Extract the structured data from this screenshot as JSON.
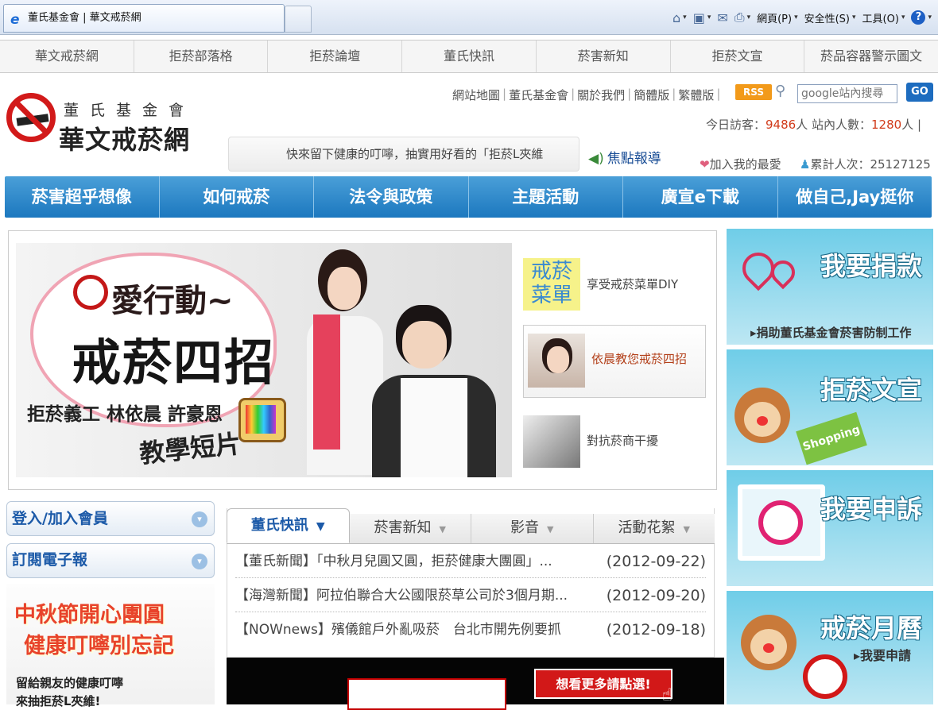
{
  "browser": {
    "tab_title": "董氏基金會 | 華文戒菸網",
    "toolbar": {
      "page_label": "網頁(P)",
      "safety_label": "安全性(S)",
      "tools_label": "工具(O)"
    }
  },
  "top_nav": [
    "華文戒菸網",
    "拒菸部落格",
    "拒菸論壇",
    "董氏快訊",
    "菸害新知",
    "拒菸文宣",
    "菸品容器警示圖文"
  ],
  "header": {
    "org_small": "董氏基金會",
    "org_big": "華文戒菸網",
    "util_links": [
      "網站地圖",
      "董氏基金會",
      "關於我們",
      "簡體版",
      "繁體版"
    ],
    "rss_label": "RSS",
    "search_placeholder": "google站內搜尋",
    "go_label": "GO",
    "visitors_today_label": "今日訪客：",
    "visitors_today": "9486",
    "visitors_unit": "人",
    "online_label": "站內人數：",
    "online_count": "1280",
    "online_unit": "人 |",
    "marquee": "快來留下健康的叮嚀，抽實用好看的「拒菸L夾維",
    "focus_label": "焦點報導",
    "favorite_label": "加入我的最愛",
    "total_label": "累計人次：25127125"
  },
  "main_nav": [
    "菸害超乎想像",
    "如何戒菸",
    "法令與政策",
    "主題活動",
    "廣宣e下載",
    "做自己,Jay挺你"
  ],
  "banner": {
    "title1": "愛行動~",
    "title2": "戒菸四招",
    "names": "拒菸義工 林依晨 許豪恩",
    "subtitle": "教學短片"
  },
  "side_links": [
    {
      "image_text": "戒菸菜單",
      "label": "享受戒菸菜單DIY"
    },
    {
      "label": "依晨教您戒菸四招"
    },
    {
      "label": "對抗菸商干擾"
    }
  ],
  "right_ads": [
    {
      "title": "我要捐款",
      "sub": "▸捐助董氏基金會菸害防制工作"
    },
    {
      "title": "拒菸文宣",
      "sub": "Shopping"
    },
    {
      "title": "我要申訴",
      "sub": ""
    },
    {
      "title": "戒菸月曆",
      "sub": "▸我要申請"
    }
  ],
  "left_col": {
    "login": "登入/加入會員",
    "subscribe": "訂閱電子報",
    "promo_line1": "中秋節開心團圓",
    "promo_line2": "健康叮嚀別忘記",
    "promo_line3": "留給親友的健康叮嚀",
    "promo_line4": "來抽拒菸L夾維!"
  },
  "news": {
    "tabs": [
      "董氏快訊",
      "菸害新知",
      "影音",
      "活動花絮"
    ],
    "items": [
      {
        "title": "【董氏新聞】「中秋月兒圓又圓，拒菸健康大團圓」...",
        "date": "(2012-09-22)"
      },
      {
        "title": "【海灣新聞】阿拉伯聯合大公國限菸草公司於3個月期...",
        "date": "(2012-09-20)"
      },
      {
        "title": "【NOWnews】殯儀館戶外亂吸菸　台北市開先例要抓",
        "date": "(2012-09-18)"
      }
    ]
  },
  "video": {
    "more_label": "想看更多請點選!"
  },
  "colors": {
    "nav_blue": "#1c78bf",
    "accent_red": "#d21818",
    "ad_blue": "#6fcde8"
  }
}
